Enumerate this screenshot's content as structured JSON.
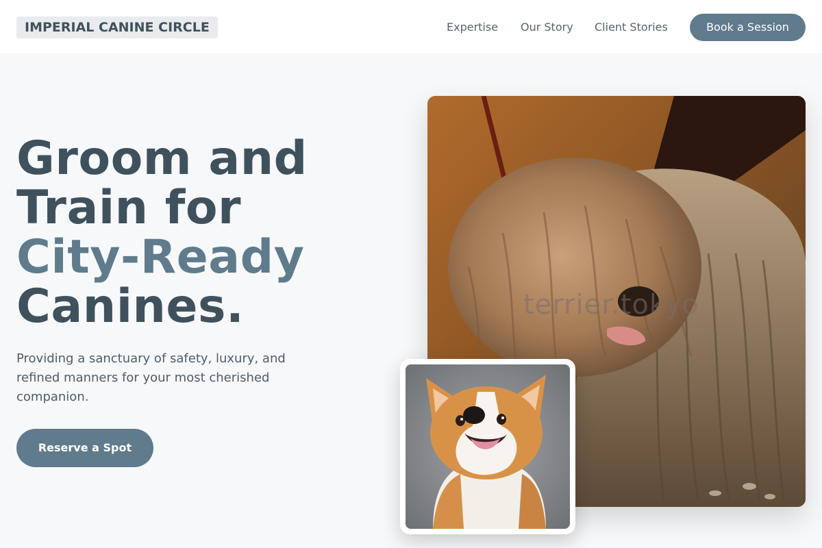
{
  "header": {
    "logo": "IMPERIAL CANINE CIRCLE",
    "nav": [
      {
        "label": "Expertise"
      },
      {
        "label": "Our Story"
      },
      {
        "label": "Client Stories"
      }
    ],
    "cta_label": "Book a Session"
  },
  "hero": {
    "headline_lines": [
      "Groom and",
      "Train for",
      "City-Ready",
      "Canines."
    ],
    "subtext": "Providing a sanctuary of safety, luxury, and refined manners for your most cherished companion.",
    "cta_label": "Reserve a Spot"
  },
  "images": {
    "main_watermark": "terrier.tokyo"
  },
  "colors": {
    "primary": "#5f7b8c",
    "heading": "#3f515c",
    "background": "#f7f8fa"
  }
}
